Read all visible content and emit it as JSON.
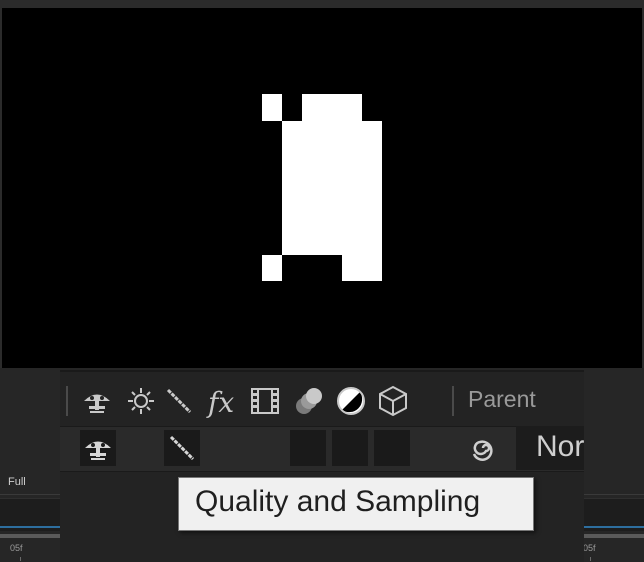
{
  "viewer": {
    "resolution_label": "Full"
  },
  "ruler": {
    "left_label": "05f",
    "right_label": "05f"
  },
  "switches_header": {
    "icons": [
      "shy-icon",
      "collapse-transform-icon",
      "quality-icon",
      "fx-icon",
      "frame-blending-icon",
      "motion-blur-icon",
      "adjustment-layer-icon",
      "3d-layer-icon"
    ],
    "parent_label": "Parent"
  },
  "layer_row": {
    "mode_value": "Normal"
  },
  "tooltip": {
    "text": "Quality and Sampling"
  },
  "colors": {
    "canvas": "#000000",
    "panel": "#232323",
    "timeline_blue": "#2d6e9e"
  }
}
